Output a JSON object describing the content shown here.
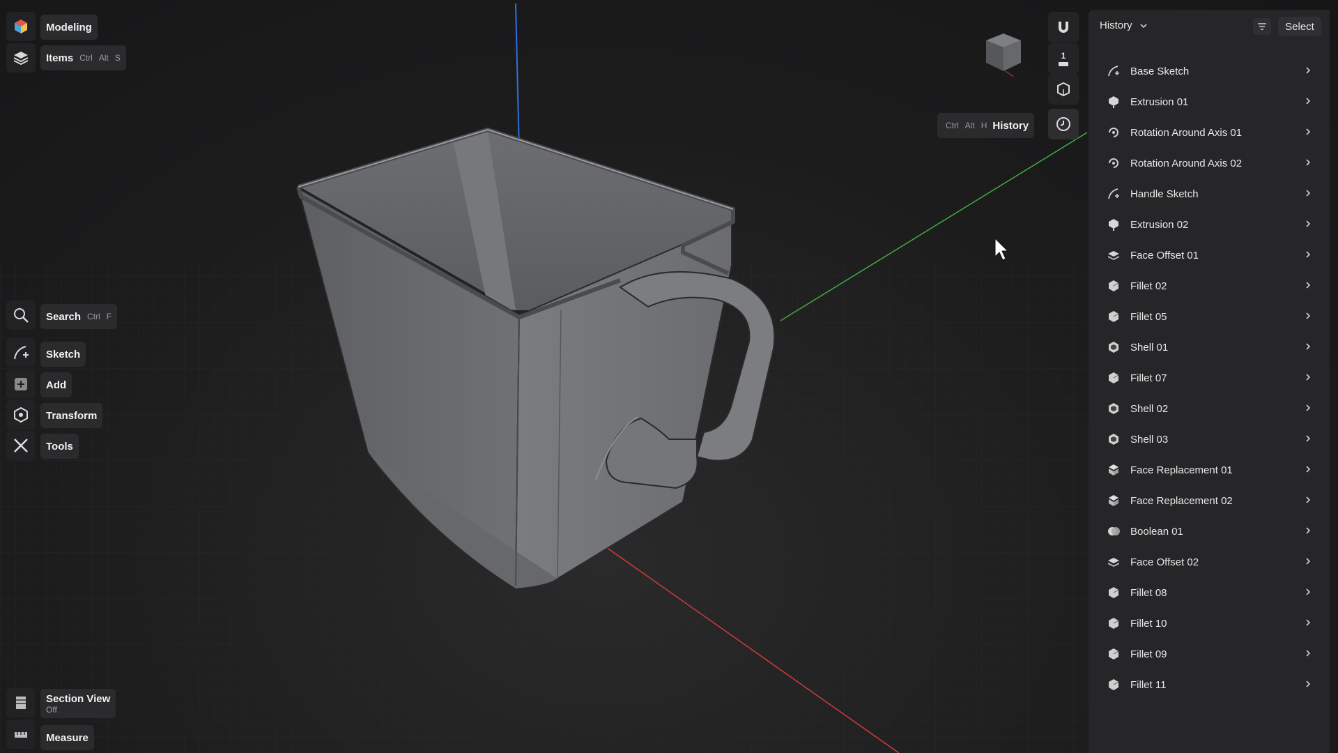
{
  "left_toolbar": {
    "modeling_label": "Modeling",
    "items_label": "Items",
    "items_shortcut": [
      "Ctrl",
      "Alt",
      "S"
    ],
    "search_label": "Search",
    "search_shortcut": [
      "Ctrl",
      "F"
    ],
    "sketch_label": "Sketch",
    "add_label": "Add",
    "transform_label": "Transform",
    "tools_label": "Tools",
    "section_view_label": "Section View",
    "section_view_state": "Off",
    "measure_label": "Measure"
  },
  "history_toggle": {
    "shortcut": [
      "Ctrl",
      "Alt",
      "H"
    ],
    "label": "History"
  },
  "history_panel": {
    "title": "History",
    "select_label": "Select",
    "items": [
      {
        "label": "Base Sketch",
        "icon": "sketch-icon"
      },
      {
        "label": "Extrusion 01",
        "icon": "extrusion-icon"
      },
      {
        "label": "Rotation Around Axis 01",
        "icon": "rotation-icon"
      },
      {
        "label": "Rotation Around Axis 02",
        "icon": "rotation-icon"
      },
      {
        "label": "Handle Sketch",
        "icon": "sketch-icon"
      },
      {
        "label": "Extrusion 02",
        "icon": "extrusion-icon"
      },
      {
        "label": "Face Offset 01",
        "icon": "face-offset-icon"
      },
      {
        "label": "Fillet 02",
        "icon": "fillet-icon"
      },
      {
        "label": "Fillet 05",
        "icon": "fillet-icon"
      },
      {
        "label": "Shell 01",
        "icon": "shell-icon"
      },
      {
        "label": "Fillet 07",
        "icon": "fillet-icon"
      },
      {
        "label": "Shell 02",
        "icon": "shell-icon"
      },
      {
        "label": "Shell 03",
        "icon": "shell-icon"
      },
      {
        "label": "Face Replacement 01",
        "icon": "face-replacement-icon"
      },
      {
        "label": "Face Replacement 02",
        "icon": "face-replacement-icon"
      },
      {
        "label": "Boolean 01",
        "icon": "boolean-icon"
      },
      {
        "label": "Face Offset 02",
        "icon": "face-offset-icon"
      },
      {
        "label": "Fillet 08",
        "icon": "fillet-icon"
      },
      {
        "label": "Fillet 10",
        "icon": "fillet-icon"
      },
      {
        "label": "Fillet 09",
        "icon": "fillet-icon"
      },
      {
        "label": "Fillet 11",
        "icon": "fillet-icon"
      }
    ]
  },
  "right_strip": {
    "snap_icon": "magnet-icon",
    "view_count": "1",
    "projection_icon": "perspective-icon",
    "history_icon": "clock-icon"
  },
  "viewport": {
    "axis_colors": {
      "x": "#d23b3b",
      "y": "#3fae3f",
      "z": "#2f6fe0"
    },
    "model_color": "#6b6d70"
  }
}
